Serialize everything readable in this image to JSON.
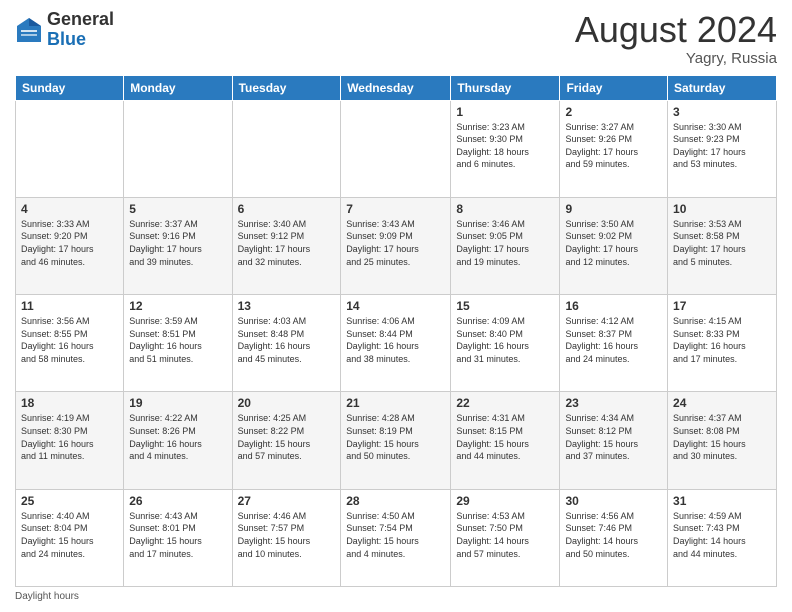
{
  "header": {
    "logo_general": "General",
    "logo_blue": "Blue",
    "month_title": "August 2024",
    "location": "Yagry, Russia"
  },
  "columns": [
    "Sunday",
    "Monday",
    "Tuesday",
    "Wednesday",
    "Thursday",
    "Friday",
    "Saturday"
  ],
  "weeks": [
    [
      {
        "day": "",
        "info": ""
      },
      {
        "day": "",
        "info": ""
      },
      {
        "day": "",
        "info": ""
      },
      {
        "day": "",
        "info": ""
      },
      {
        "day": "1",
        "info": "Sunrise: 3:23 AM\nSunset: 9:30 PM\nDaylight: 18 hours\nand 6 minutes."
      },
      {
        "day": "2",
        "info": "Sunrise: 3:27 AM\nSunset: 9:26 PM\nDaylight: 17 hours\nand 59 minutes."
      },
      {
        "day": "3",
        "info": "Sunrise: 3:30 AM\nSunset: 9:23 PM\nDaylight: 17 hours\nand 53 minutes."
      }
    ],
    [
      {
        "day": "4",
        "info": "Sunrise: 3:33 AM\nSunset: 9:20 PM\nDaylight: 17 hours\nand 46 minutes."
      },
      {
        "day": "5",
        "info": "Sunrise: 3:37 AM\nSunset: 9:16 PM\nDaylight: 17 hours\nand 39 minutes."
      },
      {
        "day": "6",
        "info": "Sunrise: 3:40 AM\nSunset: 9:12 PM\nDaylight: 17 hours\nand 32 minutes."
      },
      {
        "day": "7",
        "info": "Sunrise: 3:43 AM\nSunset: 9:09 PM\nDaylight: 17 hours\nand 25 minutes."
      },
      {
        "day": "8",
        "info": "Sunrise: 3:46 AM\nSunset: 9:05 PM\nDaylight: 17 hours\nand 19 minutes."
      },
      {
        "day": "9",
        "info": "Sunrise: 3:50 AM\nSunset: 9:02 PM\nDaylight: 17 hours\nand 12 minutes."
      },
      {
        "day": "10",
        "info": "Sunrise: 3:53 AM\nSunset: 8:58 PM\nDaylight: 17 hours\nand 5 minutes."
      }
    ],
    [
      {
        "day": "11",
        "info": "Sunrise: 3:56 AM\nSunset: 8:55 PM\nDaylight: 16 hours\nand 58 minutes."
      },
      {
        "day": "12",
        "info": "Sunrise: 3:59 AM\nSunset: 8:51 PM\nDaylight: 16 hours\nand 51 minutes."
      },
      {
        "day": "13",
        "info": "Sunrise: 4:03 AM\nSunset: 8:48 PM\nDaylight: 16 hours\nand 45 minutes."
      },
      {
        "day": "14",
        "info": "Sunrise: 4:06 AM\nSunset: 8:44 PM\nDaylight: 16 hours\nand 38 minutes."
      },
      {
        "day": "15",
        "info": "Sunrise: 4:09 AM\nSunset: 8:40 PM\nDaylight: 16 hours\nand 31 minutes."
      },
      {
        "day": "16",
        "info": "Sunrise: 4:12 AM\nSunset: 8:37 PM\nDaylight: 16 hours\nand 24 minutes."
      },
      {
        "day": "17",
        "info": "Sunrise: 4:15 AM\nSunset: 8:33 PM\nDaylight: 16 hours\nand 17 minutes."
      }
    ],
    [
      {
        "day": "18",
        "info": "Sunrise: 4:19 AM\nSunset: 8:30 PM\nDaylight: 16 hours\nand 11 minutes."
      },
      {
        "day": "19",
        "info": "Sunrise: 4:22 AM\nSunset: 8:26 PM\nDaylight: 16 hours\nand 4 minutes."
      },
      {
        "day": "20",
        "info": "Sunrise: 4:25 AM\nSunset: 8:22 PM\nDaylight: 15 hours\nand 57 minutes."
      },
      {
        "day": "21",
        "info": "Sunrise: 4:28 AM\nSunset: 8:19 PM\nDaylight: 15 hours\nand 50 minutes."
      },
      {
        "day": "22",
        "info": "Sunrise: 4:31 AM\nSunset: 8:15 PM\nDaylight: 15 hours\nand 44 minutes."
      },
      {
        "day": "23",
        "info": "Sunrise: 4:34 AM\nSunset: 8:12 PM\nDaylight: 15 hours\nand 37 minutes."
      },
      {
        "day": "24",
        "info": "Sunrise: 4:37 AM\nSunset: 8:08 PM\nDaylight: 15 hours\nand 30 minutes."
      }
    ],
    [
      {
        "day": "25",
        "info": "Sunrise: 4:40 AM\nSunset: 8:04 PM\nDaylight: 15 hours\nand 24 minutes."
      },
      {
        "day": "26",
        "info": "Sunrise: 4:43 AM\nSunset: 8:01 PM\nDaylight: 15 hours\nand 17 minutes."
      },
      {
        "day": "27",
        "info": "Sunrise: 4:46 AM\nSunset: 7:57 PM\nDaylight: 15 hours\nand 10 minutes."
      },
      {
        "day": "28",
        "info": "Sunrise: 4:50 AM\nSunset: 7:54 PM\nDaylight: 15 hours\nand 4 minutes."
      },
      {
        "day": "29",
        "info": "Sunrise: 4:53 AM\nSunset: 7:50 PM\nDaylight: 14 hours\nand 57 minutes."
      },
      {
        "day": "30",
        "info": "Sunrise: 4:56 AM\nSunset: 7:46 PM\nDaylight: 14 hours\nand 50 minutes."
      },
      {
        "day": "31",
        "info": "Sunrise: 4:59 AM\nSunset: 7:43 PM\nDaylight: 14 hours\nand 44 minutes."
      }
    ]
  ],
  "footer": {
    "note": "Daylight hours"
  }
}
